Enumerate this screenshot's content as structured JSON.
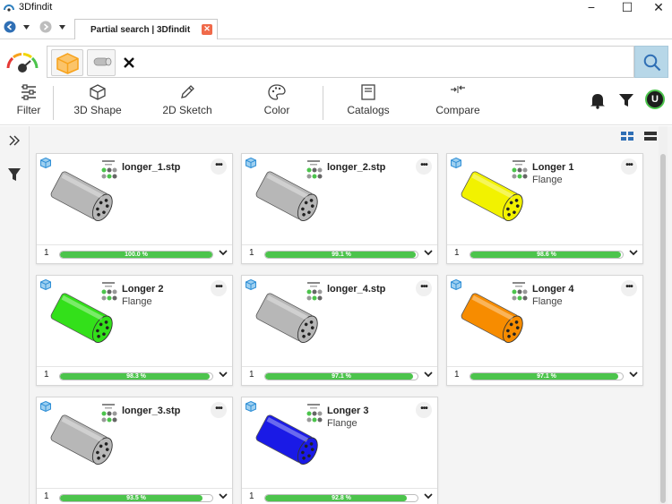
{
  "window": {
    "title": "3Dfindit",
    "minimize": "−",
    "maximize": "☐",
    "close": "✕"
  },
  "tabs": [
    {
      "label": "Partial search | 3Dfindit"
    }
  ],
  "toolbar": {
    "filter": "Filter",
    "shape": "3D Shape",
    "sketch": "2D Sketch",
    "color": "Color",
    "catalogs": "Catalogs",
    "compare": "Compare",
    "avatar": "U"
  },
  "colors": {
    "accent": "#4cc44c",
    "search_button": "#b7d7e8",
    "chip_orange": "#f7a21b"
  },
  "results": [
    {
      "name": "longer_1.stp",
      "sub": "",
      "count": "1",
      "score": 100.0,
      "pct_label": "100.0 %",
      "color": "#b7b7b7"
    },
    {
      "name": "longer_2.stp",
      "sub": "",
      "count": "1",
      "score": 99.1,
      "pct_label": "99.1 %",
      "color": "#b7b7b7"
    },
    {
      "name": "Longer 1",
      "sub": "Flange",
      "count": "1",
      "score": 98.6,
      "pct_label": "98.6 %",
      "color": "#f2f200"
    },
    {
      "name": "Longer 2",
      "sub": "Flange",
      "count": "1",
      "score": 98.3,
      "pct_label": "98.3 %",
      "color": "#33e01a"
    },
    {
      "name": "longer_4.stp",
      "sub": "",
      "count": "1",
      "score": 97.1,
      "pct_label": "97.1 %",
      "color": "#b7b7b7"
    },
    {
      "name": "Longer 4",
      "sub": "Flange",
      "count": "1",
      "score": 97.1,
      "pct_label": "97.1 %",
      "color": "#f78c00"
    },
    {
      "name": "longer_3.stp",
      "sub": "",
      "count": "1",
      "score": 93.5,
      "pct_label": "93.5 %",
      "color": "#b7b7b7"
    },
    {
      "name": "Longer 3",
      "sub": "Flange",
      "count": "1",
      "score": 92.8,
      "pct_label": "92.8 %",
      "color": "#1a1ae6"
    }
  ]
}
